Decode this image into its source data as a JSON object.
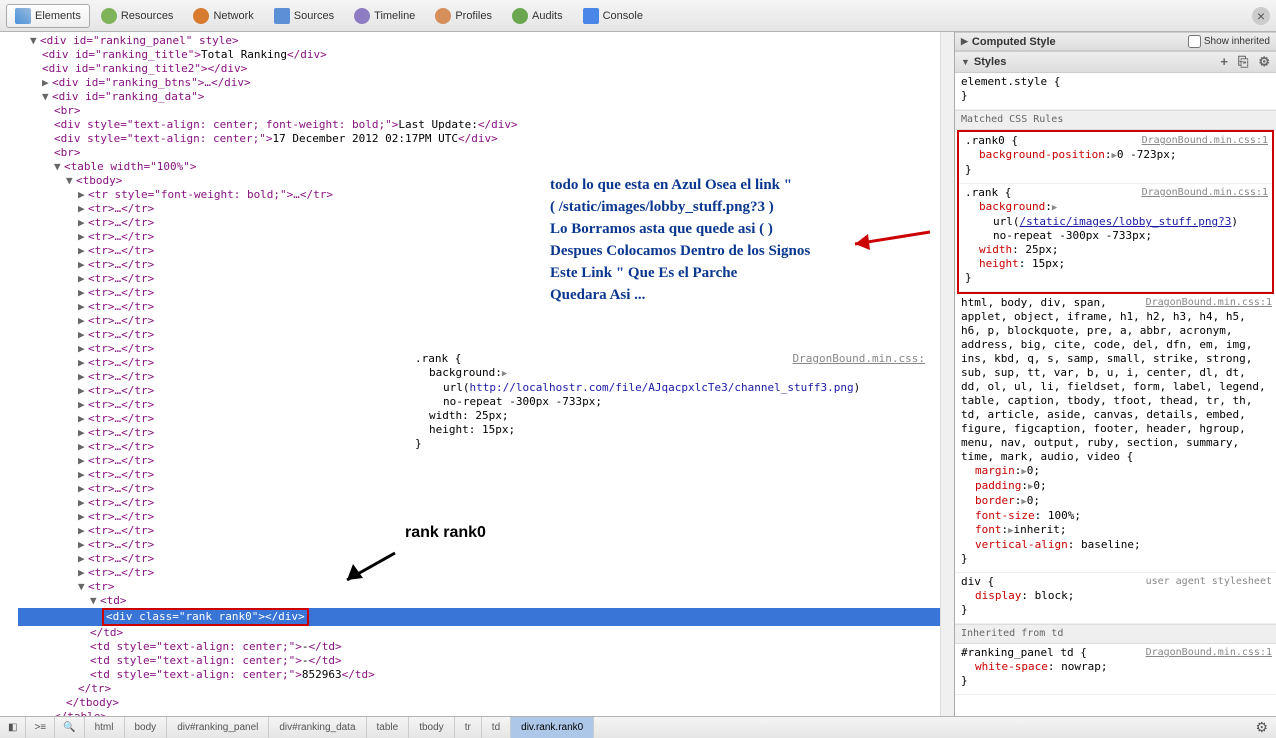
{
  "toolbar": {
    "tabs": [
      {
        "label": "Elements",
        "icon": "ic-elements",
        "active": true
      },
      {
        "label": "Resources",
        "icon": "ic-resources"
      },
      {
        "label": "Network",
        "icon": "ic-network"
      },
      {
        "label": "Sources",
        "icon": "ic-sources"
      },
      {
        "label": "Timeline",
        "icon": "ic-timeline"
      },
      {
        "label": "Profiles",
        "icon": "ic-profiles"
      },
      {
        "label": "Audits",
        "icon": "ic-audits"
      },
      {
        "label": "Console",
        "icon": "ic-console"
      }
    ]
  },
  "dom": {
    "ranking_panel_open": "<div id=\"ranking_panel\" style>",
    "ranking_title": {
      "open": "<div id=\"ranking_title\">",
      "text": "Total Ranking",
      "close": "</div>"
    },
    "ranking_title2": "<div id=\"ranking_title2\"></div>",
    "ranking_btns": "<div id=\"ranking_btns\">…</div>",
    "ranking_data_open": "<div id=\"ranking_data\">",
    "br": "<br>",
    "last_update": {
      "open": "<div style=\"text-align: center; font-weight: bold;\">",
      "text": "Last Update:",
      "close": "</div>"
    },
    "timestamp": {
      "open": "<div style=\"text-align: center;\">",
      "text": "17 December 2012 02:17PM UTC",
      "close": "</div>"
    },
    "table_open": "<table width=\"100%\">",
    "tbody_open": "<tbody>",
    "tr_bold": "<tr style=\"font-weight: bold;\">…</tr>",
    "tr_closed": "<tr>…</tr>",
    "tr_open": "<tr>",
    "td_open": "<td>",
    "div_rank": "<div class=\"rank rank0\"></div>",
    "td_close": "</td>",
    "td_dash": {
      "open": "<td style=\"text-align: center;\">",
      "text": "-",
      "close": "</td>"
    },
    "td_num": {
      "open": "<td style=\"text-align: center;\">",
      "text": "852963",
      "close": "</td>"
    },
    "tr_close": "</tr>",
    "tbody_close": "</tbody>",
    "table_close": "</table>"
  },
  "annotations": {
    "line1": "todo lo que esta en Azul  Osea el link \"",
    "line2": "( /static/images/lobby_stuff.png?3 )",
    "line3": "Lo Borramos  asta que quede asi ( )",
    "line4": "Despues Colocamos Dentro de los Signos",
    "line5": "Este Link \" Que Es el Parche",
    "line6": "Quedara Asi ...",
    "label_rank": "rank rank0"
  },
  "example": {
    "selector": ".rank {",
    "source": "DragonBound.min.css:",
    "p1": "background:",
    "p2_pre": "url(",
    "p2_url": "http://localhostr.com/file/AJqacpxlcTe3/channel_stuff3.png",
    "p2_post": ")",
    "p3": "no-repeat -300px -733px;",
    "p4": "width: 25px;",
    "p5": "height: 15px;"
  },
  "styles": {
    "computed": "Computed Style",
    "show_inherited": "Show inherited",
    "styles_header": "Styles",
    "element_style": "element.style {",
    "close": "}",
    "matched_header": "Matched CSS Rules",
    "rank0": {
      "selector": ".rank0 {",
      "source": "DragonBound.min.css:1",
      "p1_name": "background-position",
      "p1_val": "0 -723px;"
    },
    "rank": {
      "selector": ".rank {",
      "source": "DragonBound.min.css:1",
      "p1_name": "background",
      "p2_pre": "url(",
      "p2_url": "/static/images/lobby_stuff.png?3",
      "p2_post": ")",
      "p3": "no-repeat -300px -733px;",
      "p4_name": "width",
      "p4_val": "25px;",
      "p5_name": "height",
      "p5_val": "15px;"
    },
    "reset": {
      "selector": "html, body, div, span, applet, object, iframe, h1, h2, h3, h4, h5, h6, p, blockquote, pre, a, abbr, acronym, address, big, cite, code, del, dfn, em, img, ins, kbd, q, s, samp, small, strike, strong, sub, sup, tt, var, b, u, i, center, dl, dt, dd, ol, ul, li, fieldset, form, label, legend, table, caption, tbody, tfoot, thead, tr, th, td, article, aside, canvas, details, embed, figure, figcaption, footer, header, hgroup, menu, nav, output, ruby, section, summary, time, mark, audio, video {",
      "source": "DragonBound.min.css:1",
      "props": [
        {
          "name": "margin",
          "val": "0;"
        },
        {
          "name": "padding",
          "val": "0;"
        },
        {
          "name": "border",
          "val": "0;"
        },
        {
          "name": "font-size",
          "val": "100%;"
        },
        {
          "name": "font",
          "val": "inherit;"
        },
        {
          "name": "vertical-align",
          "val": "baseline;"
        }
      ]
    },
    "div_rule": {
      "selector": "div {",
      "source": "user agent stylesheet",
      "p_name": "display",
      "p_val": "block;"
    },
    "inherited_from": "Inherited from td",
    "ranking_td": {
      "selector": "#ranking_panel td {",
      "source": "DragonBound.min.css:1",
      "p_name": "white-space",
      "p_val": "nowrap;"
    }
  },
  "breadcrumbs": [
    "html",
    "body",
    "div#ranking_panel",
    "div#ranking_data",
    "table",
    "tbody",
    "tr",
    "td",
    "div.rank.rank0"
  ]
}
